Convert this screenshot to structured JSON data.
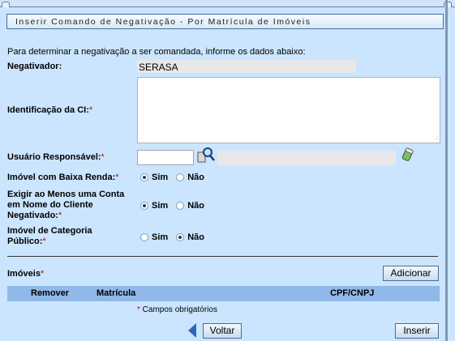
{
  "title": "Inserir Comando de Negativação - Por Matrícula de Imóveis",
  "intro": "Para determinar a negativação a ser comandada, informe os dados abaixo:",
  "negativador": {
    "label": "Negativador:",
    "value": "SERASA"
  },
  "identificacao": {
    "label": "Identificação da CI:",
    "required": "*"
  },
  "usuario": {
    "label": "Usuário Responsável:",
    "required": "*"
  },
  "baixa_renda": {
    "label": "Imóvel com Baixa Renda:",
    "required": "*",
    "sim": "Sim",
    "nao": "Não",
    "selected": "sim"
  },
  "exigir_conta": {
    "label_line1": "Exigir ao Menos uma Conta",
    "label_line2": "em Nome do Cliente",
    "label_line3": "Negativado:",
    "required": "*",
    "sim": "Sim",
    "nao": "Não",
    "selected": "sim"
  },
  "categoria_publico": {
    "label_line1": "Imóvel de Categoria",
    "label_line2": "Público:",
    "required": "*",
    "sim": "Sim",
    "nao": "Não",
    "selected": "nao"
  },
  "imoveis": {
    "label": "Imóveis",
    "required": "*",
    "add_button": "Adicionar"
  },
  "table": {
    "col_remover": "Remover",
    "col_matricula": "Matrícula",
    "col_cpf": "CPF/CNPJ"
  },
  "footer": {
    "required_mark": "*",
    "note": " Campos obrigatórios",
    "back": "Voltar",
    "insert": "Inserir"
  }
}
